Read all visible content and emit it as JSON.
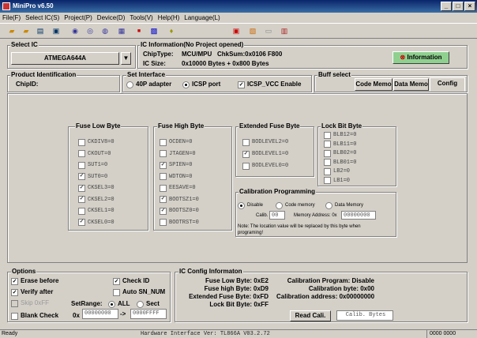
{
  "window": {
    "title": "MiniPro v6.50"
  },
  "menu": [
    "File(F)",
    "Select IC(S)",
    "Project(P)",
    "Device(D)",
    "Tools(V)",
    "Help(H)",
    "Language(L)"
  ],
  "select_ic": {
    "title": "Select IC",
    "value": "ATMEGA644A"
  },
  "ic_info": {
    "title": "IC Information(No Project opened)",
    "chiptype_label": "ChipType:",
    "chiptype": "MCU/MPU",
    "chksum": "ChkSum:0x0106 F800",
    "icsize_label": "IC Size:",
    "icsize": "0x10000 Bytes + 0x800 Bytes",
    "info_button": "Information"
  },
  "product_id": {
    "title": "Product Identification",
    "chipid_label": "ChipID:"
  },
  "set_interface": {
    "title": "Set Interface",
    "opt1": "40P adapter",
    "opt2": "ICSP port",
    "icsp_vcc": "ICSP_VCC Enable"
  },
  "buff_select": {
    "title": "Buff select",
    "tabs": [
      "Code Memo",
      "Data Memo",
      "Config"
    ]
  },
  "fuse_low": {
    "title": "Fuse Low Byte",
    "items": [
      {
        "label": "CKDIV8=0",
        "checked": false
      },
      {
        "label": "CKOUT=0",
        "checked": false
      },
      {
        "label": "SUT1=0",
        "checked": false
      },
      {
        "label": "SUT0=0",
        "checked": true
      },
      {
        "label": "CKSEL3=0",
        "checked": true
      },
      {
        "label": "CKSEL2=0",
        "checked": true
      },
      {
        "label": "CKSEL1=0",
        "checked": false
      },
      {
        "label": "CKSEL0=0",
        "checked": true
      }
    ]
  },
  "fuse_high": {
    "title": "Fuse High Byte",
    "items": [
      {
        "label": "OCDEN=0",
        "checked": false
      },
      {
        "label": "JTAGEN=0",
        "checked": false
      },
      {
        "label": "SPIEN=0",
        "checked": true
      },
      {
        "label": "WDTON=0",
        "checked": false
      },
      {
        "label": "EESAVE=0",
        "checked": false
      },
      {
        "label": "BOOTSZ1=0",
        "checked": true
      },
      {
        "label": "BOOTSZ0=0",
        "checked": true
      },
      {
        "label": "BOOTRST=0",
        "checked": false
      }
    ]
  },
  "ext_fuse": {
    "title": "Extended Fuse Byte",
    "items": [
      {
        "label": "BODLEVEL2=0",
        "checked": false
      },
      {
        "label": "BODLEVEL1=0",
        "checked": true
      },
      {
        "label": "BODLEVEL0=0",
        "checked": false
      }
    ]
  },
  "lock_bit": {
    "title": "Lock Bit Byte",
    "items": [
      {
        "label": "BLB12=0",
        "checked": false
      },
      {
        "label": "BLB11=0",
        "checked": false
      },
      {
        "label": "BLB02=0",
        "checked": false
      },
      {
        "label": "BLB01=0",
        "checked": false
      },
      {
        "label": "LB2=0",
        "checked": false
      },
      {
        "label": "LB1=0",
        "checked": false
      }
    ]
  },
  "calib": {
    "title": "Calibration Programming",
    "opt1": "Disable",
    "opt2": "Code memory",
    "opt3": "Data Memory",
    "calib_label": "Calib.",
    "calib_value": "00",
    "addr_label": "Memory Address: 0x",
    "addr_value": "00000000",
    "note1": "Note: The location value will be replaced by this byte  when",
    "note2": "programing!"
  },
  "options": {
    "title": "Options",
    "erase": "Erase before",
    "verify": "Verify after",
    "skip": "Skip 0xFF",
    "blank": "Blank Check",
    "checkid": "Check ID",
    "auto_sn": "Auto SN_NUM",
    "setrange": "SetRange:",
    "all": "ALL",
    "sect": "Sect",
    "ox": "0x",
    "range_start": "00000000",
    "arrow": "->",
    "range_end": "0000FFFF"
  },
  "ic_config": {
    "title": "IC Config Informaton",
    "fuse_low": "Fuse Low Byte: 0xE2",
    "fuse_high": "Fuse high Byte: 0xD9",
    "ext_fuse": "Extended Fuse Byte: 0xFD",
    "lock_bit": "Lock Bit Byte: 0xFF",
    "calib_program": "Calibration Program: Disable",
    "calib_byte": "Calibration byte: 0x00",
    "calib_addr": "Calibration address: 0x00000000",
    "read_cali": "Read Cali.",
    "calib_bytes": "Calib. Bytes"
  },
  "status": {
    "ready": "Ready",
    "hw": "Hardware Interface Ver: TL866A V03.2.72",
    "code": "0000 0000"
  }
}
